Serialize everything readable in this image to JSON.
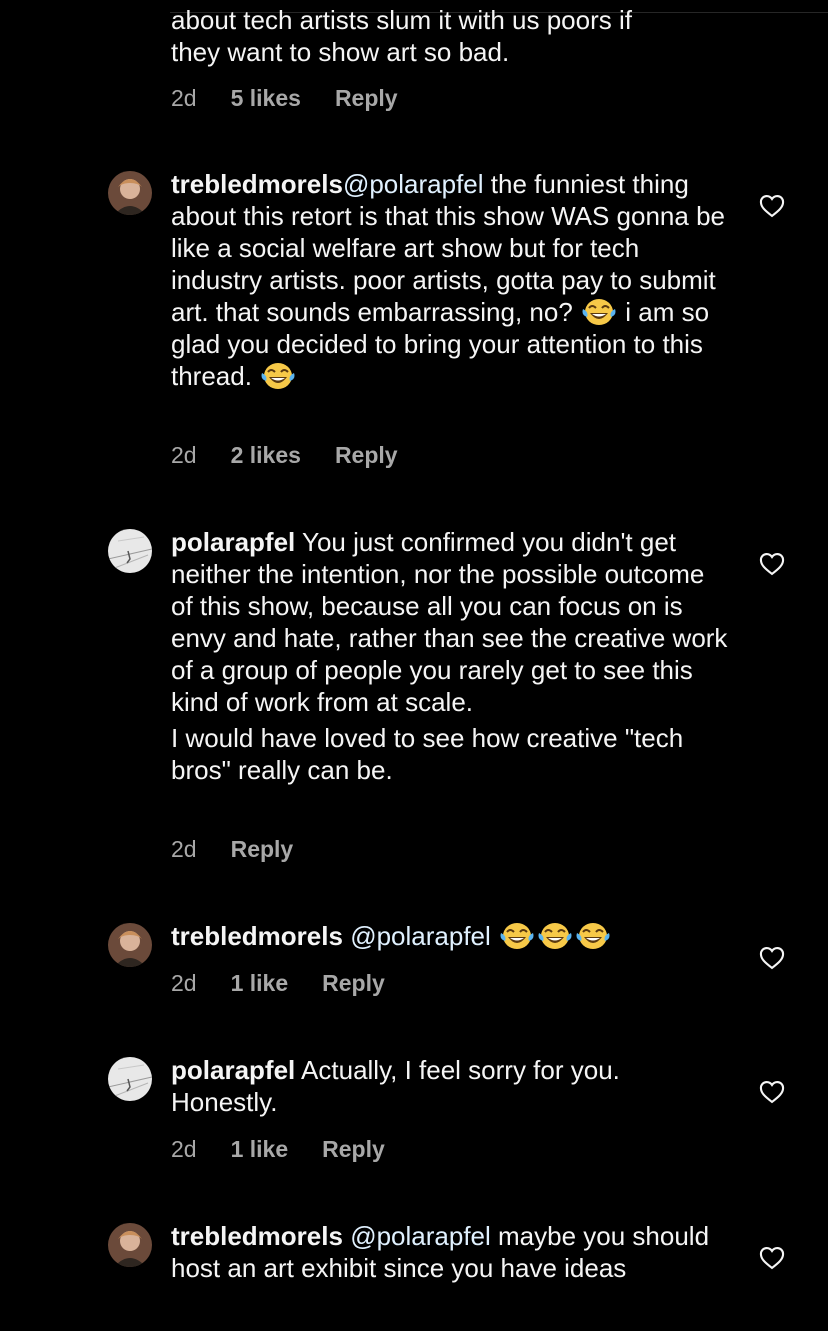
{
  "comments": [
    {
      "lines": [
        "about tech artists slum it with us poors if",
        "they want to show art so bad."
      ],
      "time": "2d",
      "likes": "5 likes",
      "reply": "Reply"
    },
    {
      "user": "trebledmorels",
      "mention": "@polarapfel",
      "seg1": " the funniest thing about this retort is that this show WAS gonna be like a social welfare art show but for tech industry artists. poor artists, gotta pay to submit art. that sounds embarrassing, no? ",
      "seg2": " i am so glad you decided to bring your attention to this thread. ",
      "time": "2d",
      "likes": "2 likes",
      "reply": "Reply"
    },
    {
      "user": "polarapfel",
      "body": " You just confirmed you didn't get neither the intention, nor the possible outcome of this show, because all you can focus on is envy and hate, rather than see the creative work of a group of people you rarely get to see this kind of work from at scale.",
      "body2": "I would have loved to see how creative \"tech bros\" really can be.",
      "time": "2d",
      "reply": "Reply"
    },
    {
      "user": "trebledmorels",
      "mention": "@polarapfel",
      "time": "2d",
      "likes": "1 like",
      "reply": "Reply"
    },
    {
      "user": "polarapfel",
      "body": " Actually, I feel sorry for you. Honestly.",
      "time": "2d",
      "likes": "1 like",
      "reply": "Reply"
    },
    {
      "user": "trebledmorels",
      "mention": "@polarapfel",
      "body": " maybe you should host an art exhibit since you have ideas"
    }
  ],
  "icons": {
    "heart": "heart-outline-icon",
    "emoji": "face-with-tears-of-joy-icon"
  },
  "colors": {
    "background": "#000000",
    "text": "#f5f5f5",
    "meta": "#a8a8a8",
    "mention": "#e0f1ff"
  }
}
